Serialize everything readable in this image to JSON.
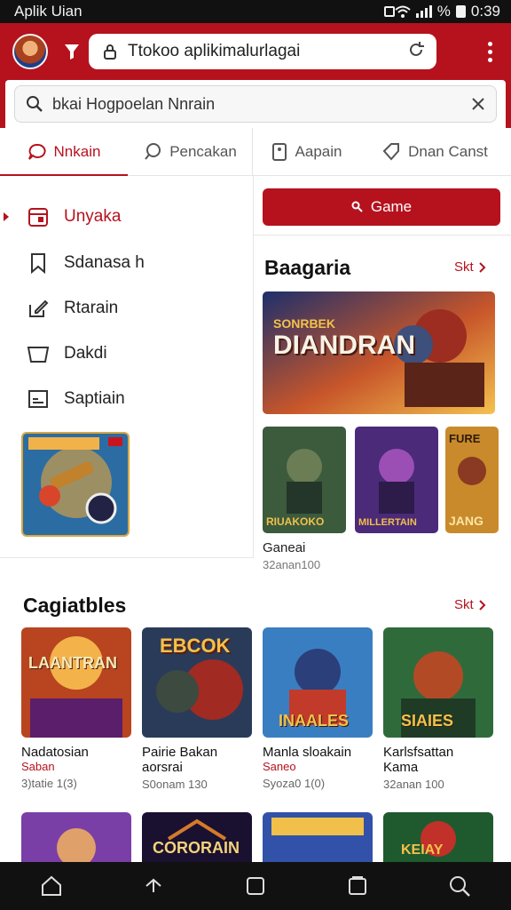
{
  "status_bar": {
    "app_name": "Aplik Uian",
    "battery_text": "%",
    "time": "0:39"
  },
  "header": {
    "url": "Ttokoo aplikimalurlagai",
    "url_icon": "lock-icon",
    "reload_icon": "reload-icon"
  },
  "search": {
    "query": "bkai Hogpoelan Nnrain",
    "placeholder": "bkai Hogpoelan Nnrain"
  },
  "tabs": [
    {
      "label": "Nnkain",
      "icon": "chat-icon",
      "active": true
    },
    {
      "label": "Pencakan",
      "icon": "search-bubble-icon",
      "active": false
    },
    {
      "label": "Aapain",
      "icon": "phone-icon",
      "active": false
    },
    {
      "label": "Dnan Canst",
      "icon": "tag-icon",
      "active": false
    }
  ],
  "side_menu": [
    {
      "label": "Unyaka",
      "icon": "calendar-icon",
      "active": true
    },
    {
      "label": "Sdanasa  h",
      "icon": "bookmark-icon",
      "active": false
    },
    {
      "label": "Rtarain",
      "icon": "edit-box-icon",
      "active": false
    },
    {
      "label": "Dakdi",
      "icon": "basket-icon",
      "active": false
    },
    {
      "label": "Saptiain",
      "icon": "card-icon",
      "active": false
    }
  ],
  "right_panel": {
    "button_label": "Game",
    "section_title": "Baagaria",
    "see_all": "Skt",
    "banner_title": "DIANDRAN",
    "banner_sub": "SONRBEK",
    "thumbs": [
      "RIUAKOKO",
      "MILLERTAIN",
      "JANG"
    ],
    "thumb_top_label": "FURE",
    "small_name": "Ganeai",
    "small_sub": "32anan100"
  },
  "bottom_section": {
    "title": "Cagiatbles",
    "see_all": "Skt",
    "cards": [
      {
        "art": "LAANTRAN",
        "name": "Nadatosian",
        "tag": "Saban",
        "meta": "3)tatie 1(3)"
      },
      {
        "art": "EBCOK",
        "name": "Pairie Bakan",
        "tag": "",
        "sub": "aorsrai",
        "meta": "S0onam 130"
      },
      {
        "art": "INAALES",
        "name": "Manla sloakain",
        "tag": "Saneo",
        "meta": "Syoza0 1(0)"
      },
      {
        "art": "SIAIES",
        "name": "Karlsfsattan",
        "tag": "",
        "sub": "Kama",
        "meta": "32anan 100"
      }
    ],
    "row2": [
      "",
      "CORORAIN",
      "",
      "KEIAY"
    ]
  },
  "colors": {
    "brand": "#b5121e"
  },
  "nav": [
    "home-icon",
    "back-icon",
    "tab-icon",
    "tabs-icon",
    "search-icon"
  ]
}
